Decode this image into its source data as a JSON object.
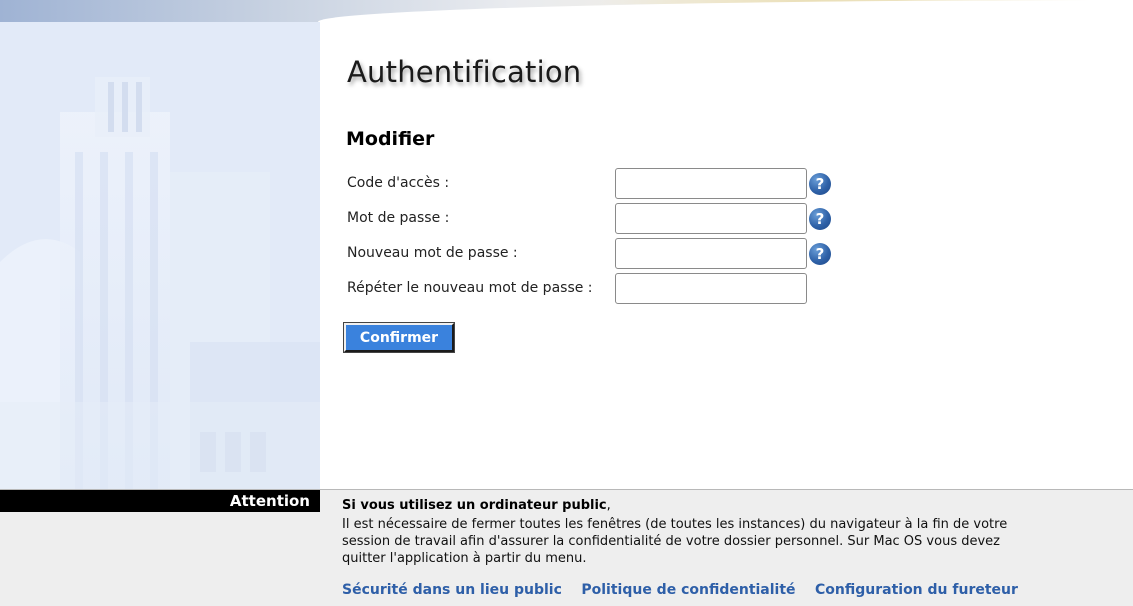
{
  "page": {
    "title": "Authentification",
    "subtitle": "Modifier"
  },
  "form": {
    "fields": [
      {
        "label": "Code d'accès :",
        "value": "",
        "has_help": true
      },
      {
        "label": "Mot de passe :",
        "value": "",
        "has_help": true
      },
      {
        "label": "Nouveau mot de passe :",
        "value": "",
        "has_help": true
      },
      {
        "label": "Répéter le nouveau mot de passe :",
        "value": "",
        "has_help": false
      }
    ],
    "help_glyph": "?",
    "help_icon": "question-circle-icon",
    "submit_label": "Confirmer"
  },
  "footer": {
    "attention_label": "Attention",
    "notice_heading_bold": "Si vous utilisez un ordinateur public",
    "notice_heading_tail": ",",
    "notice_body": "Il est nécessaire de fermer toutes les fenêtres (de toutes les instances) du navigateur à la fin de votre session de travail afin d'assurer la confidentialité de votre dossier personnel. Sur Mac OS vous devez quitter l'application à partir du menu.",
    "links": [
      "Sécurité dans un lieu public",
      "Politique de confidentialité",
      "Configuration du fureteur"
    ]
  },
  "colors": {
    "button_bg": "#3a82dd",
    "link": "#2e5fa8",
    "help_icon": "#2f62a8",
    "attention_bg": "#000000",
    "footer_bg": "#eeeeee"
  }
}
